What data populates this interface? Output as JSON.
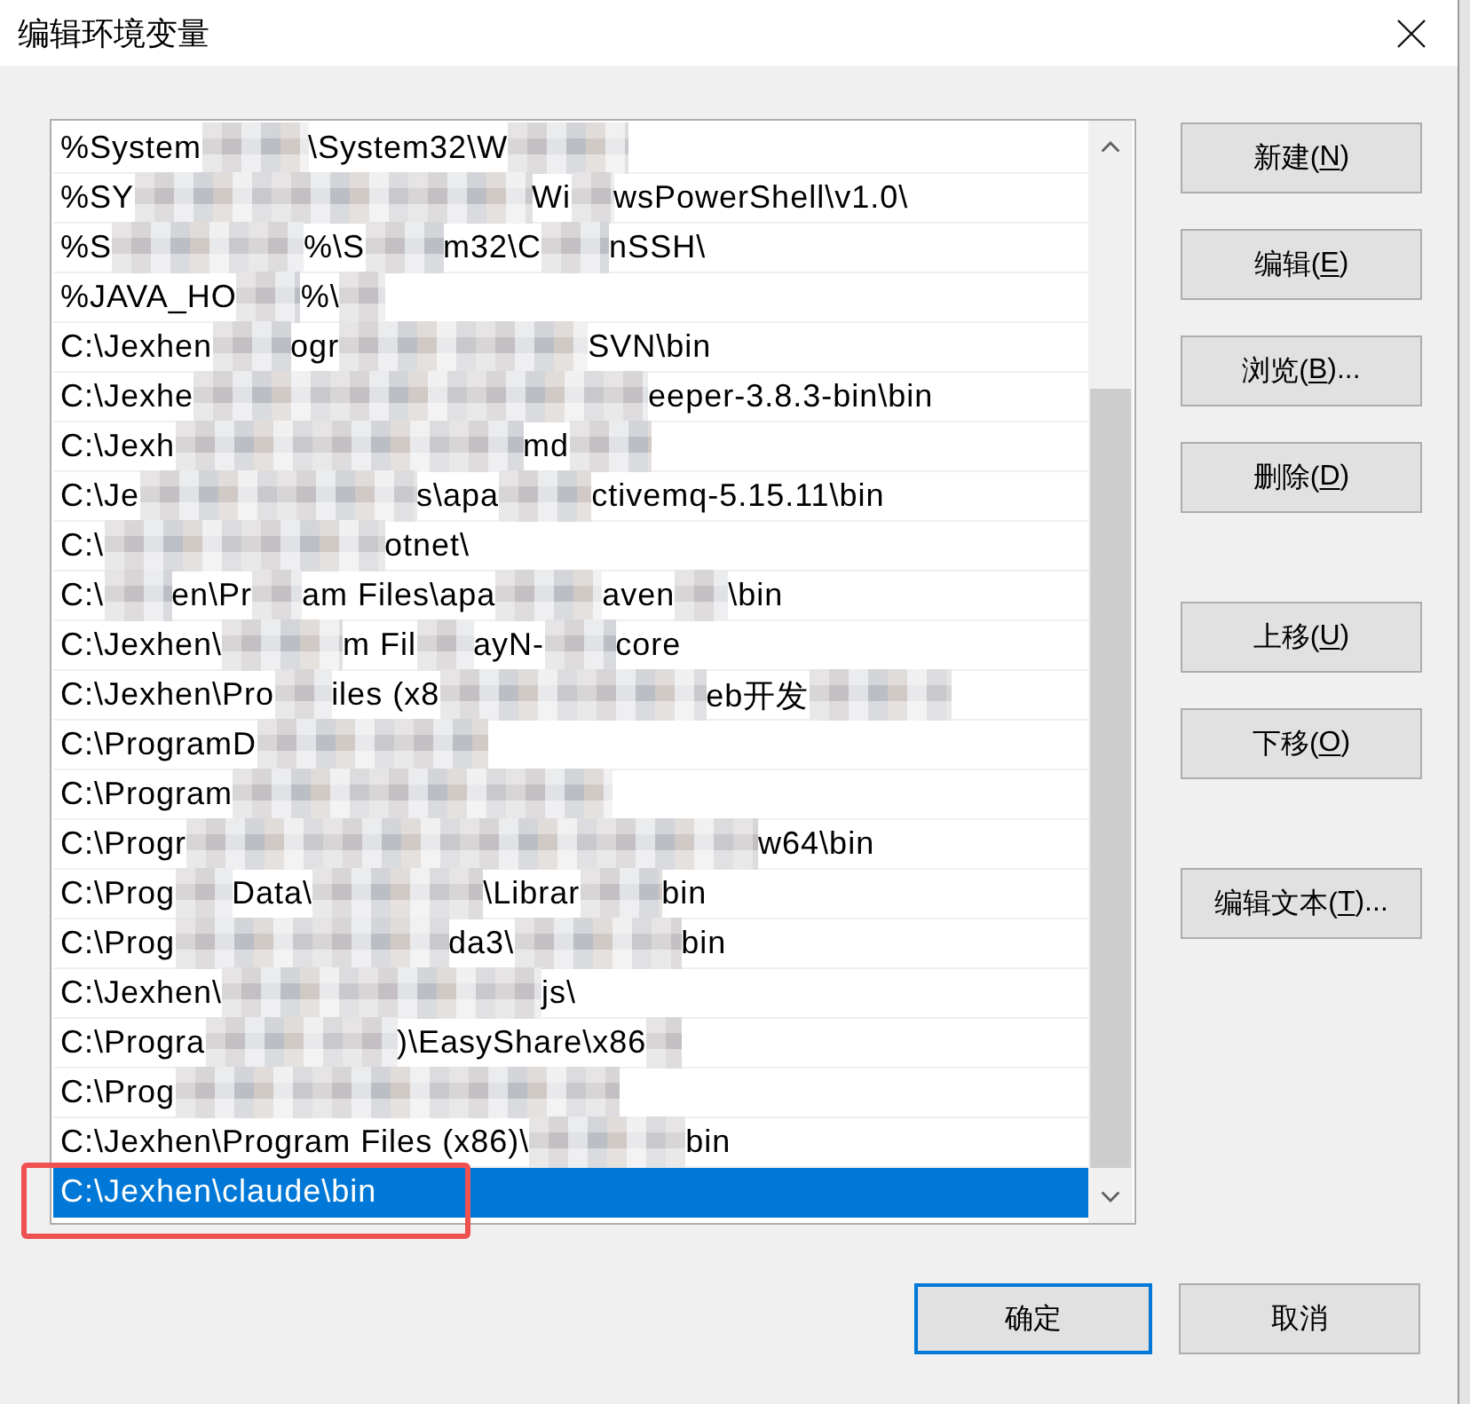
{
  "window": {
    "title": "编辑环境变量"
  },
  "path_list": {
    "rows": [
      {
        "selected": false,
        "highlighted": false,
        "segments": [
          {
            "kind": "text",
            "text": "%System"
          },
          {
            "kind": "mosaic"
          },
          {
            "kind": "text",
            "text": "\\System32\\W"
          },
          {
            "kind": "mosaic"
          }
        ]
      },
      {
        "selected": false,
        "highlighted": false,
        "segments": [
          {
            "kind": "text",
            "text": "%SY"
          },
          {
            "kind": "mosaic"
          },
          {
            "kind": "text",
            "text": "Wi"
          },
          {
            "kind": "mosaic"
          },
          {
            "kind": "text",
            "text": "wsPowerShell\\v1.0\\"
          }
        ]
      },
      {
        "selected": false,
        "highlighted": false,
        "segments": [
          {
            "kind": "text",
            "text": "%S"
          },
          {
            "kind": "mosaic"
          },
          {
            "kind": "text",
            "text": "%\\S"
          },
          {
            "kind": "mosaic"
          },
          {
            "kind": "text",
            "text": "m32\\C"
          },
          {
            "kind": "mosaic"
          },
          {
            "kind": "text",
            "text": "nSSH\\"
          }
        ]
      },
      {
        "selected": false,
        "highlighted": false,
        "segments": [
          {
            "kind": "text",
            "text": "%JAVA_HO"
          },
          {
            "kind": "mosaic"
          },
          {
            "kind": "text",
            "text": "%\\"
          },
          {
            "kind": "mosaic"
          }
        ]
      },
      {
        "selected": false,
        "highlighted": false,
        "segments": [
          {
            "kind": "text",
            "text": "C:\\Jexhen"
          },
          {
            "kind": "mosaic"
          },
          {
            "kind": "text",
            "text": "ogr"
          },
          {
            "kind": "mosaic"
          },
          {
            "kind": "text",
            "text": "SVN\\bin"
          }
        ]
      },
      {
        "selected": false,
        "highlighted": false,
        "segments": [
          {
            "kind": "text",
            "text": "C:\\Jexhe"
          },
          {
            "kind": "mosaic"
          },
          {
            "kind": "text",
            "text": "eeper-3.8.3-bin\\bin"
          }
        ]
      },
      {
        "selected": false,
        "highlighted": false,
        "segments": [
          {
            "kind": "text",
            "text": "C:\\Jexh"
          },
          {
            "kind": "mosaic"
          },
          {
            "kind": "text",
            "text": "md"
          },
          {
            "kind": "mosaic"
          }
        ]
      },
      {
        "selected": false,
        "highlighted": false,
        "segments": [
          {
            "kind": "text",
            "text": "C:\\Je"
          },
          {
            "kind": "mosaic"
          },
          {
            "kind": "text",
            "text": "s\\apa"
          },
          {
            "kind": "mosaic"
          },
          {
            "kind": "text",
            "text": "ctivemq-5.15.11\\bin"
          }
        ]
      },
      {
        "selected": false,
        "highlighted": false,
        "segments": [
          {
            "kind": "text",
            "text": "C:\\"
          },
          {
            "kind": "mosaic"
          },
          {
            "kind": "text",
            "text": "otnet\\"
          }
        ]
      },
      {
        "selected": false,
        "highlighted": false,
        "segments": [
          {
            "kind": "text",
            "text": "C:\\"
          },
          {
            "kind": "mosaic"
          },
          {
            "kind": "text",
            "text": "en\\Pr"
          },
          {
            "kind": "mosaic"
          },
          {
            "kind": "text",
            "text": "am Files\\apa"
          },
          {
            "kind": "mosaic"
          },
          {
            "kind": "text",
            "text": "aven"
          },
          {
            "kind": "mosaic"
          },
          {
            "kind": "text",
            "text": "\\bin"
          }
        ]
      },
      {
        "selected": false,
        "highlighted": false,
        "segments": [
          {
            "kind": "text",
            "text": "C:\\Jexhen\\"
          },
          {
            "kind": "mosaic"
          },
          {
            "kind": "text",
            "text": "m Fil"
          },
          {
            "kind": "mosaic"
          },
          {
            "kind": "text",
            "text": "ayN-"
          },
          {
            "kind": "mosaic"
          },
          {
            "kind": "text",
            "text": "core"
          }
        ]
      },
      {
        "selected": false,
        "highlighted": false,
        "segments": [
          {
            "kind": "text",
            "text": "C:\\Jexhen\\Pro"
          },
          {
            "kind": "mosaic"
          },
          {
            "kind": "text",
            "text": "iles (x8"
          },
          {
            "kind": "mosaic"
          },
          {
            "kind": "text",
            "text": "eb开发"
          },
          {
            "kind": "mosaic"
          }
        ]
      },
      {
        "selected": false,
        "highlighted": false,
        "segments": [
          {
            "kind": "text",
            "text": "C:\\ProgramD"
          },
          {
            "kind": "mosaic"
          }
        ]
      },
      {
        "selected": false,
        "highlighted": false,
        "segments": [
          {
            "kind": "text",
            "text": "C:\\Program"
          },
          {
            "kind": "mosaic"
          }
        ]
      },
      {
        "selected": false,
        "highlighted": false,
        "segments": [
          {
            "kind": "text",
            "text": "C:\\Progr"
          },
          {
            "kind": "mosaic"
          },
          {
            "kind": "text",
            "text": "w64\\bin"
          }
        ]
      },
      {
        "selected": false,
        "highlighted": false,
        "segments": [
          {
            "kind": "text",
            "text": "C:\\Prog"
          },
          {
            "kind": "mosaic"
          },
          {
            "kind": "text",
            "text": "Data\\"
          },
          {
            "kind": "mosaic"
          },
          {
            "kind": "text",
            "text": "\\Librar"
          },
          {
            "kind": "mosaic"
          },
          {
            "kind": "text",
            "text": "bin"
          }
        ]
      },
      {
        "selected": false,
        "highlighted": false,
        "segments": [
          {
            "kind": "text",
            "text": "C:\\Prog"
          },
          {
            "kind": "mosaic"
          },
          {
            "kind": "text",
            "text": "da3\\"
          },
          {
            "kind": "mosaic"
          },
          {
            "kind": "text",
            "text": "bin"
          }
        ]
      },
      {
        "selected": false,
        "highlighted": false,
        "segments": [
          {
            "kind": "text",
            "text": "C:\\Jexhen\\"
          },
          {
            "kind": "mosaic"
          },
          {
            "kind": "text",
            "text": "js\\"
          }
        ]
      },
      {
        "selected": false,
        "highlighted": false,
        "segments": [
          {
            "kind": "text",
            "text": "C:\\Progra"
          },
          {
            "kind": "mosaic"
          },
          {
            "kind": "text",
            "text": ")\\EasyShare\\x86"
          },
          {
            "kind": "mosaic"
          }
        ]
      },
      {
        "selected": false,
        "highlighted": false,
        "segments": [
          {
            "kind": "text",
            "text": "C:\\Prog"
          },
          {
            "kind": "mosaic"
          }
        ]
      },
      {
        "selected": false,
        "highlighted": false,
        "segments": [
          {
            "kind": "text",
            "text": "C:\\Jexhen\\Program Files (x86)\\"
          },
          {
            "kind": "mosaic"
          },
          {
            "kind": "text",
            "text": "bin"
          }
        ]
      },
      {
        "selected": true,
        "highlighted": true,
        "segments": [
          {
            "kind": "text",
            "text": "C:\\Jexhen\\claude\\bin"
          }
        ]
      }
    ]
  },
  "button_groups": [
    [
      {
        "label": "新建(",
        "access_key": "N",
        "label_end": ")"
      },
      {
        "label": "编辑(",
        "access_key": "E",
        "label_end": ")"
      },
      {
        "label": "浏览(",
        "access_key": "B",
        "label_end": ")..."
      },
      {
        "label": "删除(",
        "access_key": "D",
        "label_end": ")"
      }
    ],
    [
      {
        "label": "上移(",
        "access_key": "U",
        "label_end": ")"
      },
      {
        "label": "下移(",
        "access_key": "O",
        "label_end": ")"
      }
    ],
    [
      {
        "label": "编辑文本(",
        "access_key": "T",
        "label_end": ")..."
      }
    ]
  ],
  "footer_buttons": [
    {
      "label": "确定",
      "default": true
    },
    {
      "label": "取消",
      "default": false
    }
  ]
}
